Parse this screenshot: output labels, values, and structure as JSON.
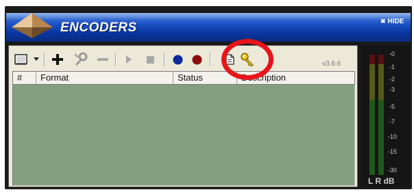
{
  "window": {
    "title": "ENCODERS",
    "hide_label": "HIDE"
  },
  "toolbar": {
    "version": "v3.6.6",
    "buttons": [
      {
        "name": "encoder-menu-icon"
      },
      {
        "name": "dropdown-arrow-icon"
      },
      {
        "name": "add-icon"
      },
      {
        "name": "settings-tools-icon"
      },
      {
        "name": "remove-icon"
      },
      {
        "name": "play-icon"
      },
      {
        "name": "stop-icon"
      },
      {
        "name": "blue-record-icon",
        "color": "#0a2c9c"
      },
      {
        "name": "red-record-icon",
        "color": "#8a0d0d"
      },
      {
        "name": "document-icon"
      },
      {
        "name": "key-icon",
        "color": "#e8c21a"
      }
    ]
  },
  "table": {
    "columns": [
      "#",
      "Format",
      "Status",
      "Description"
    ],
    "rows": []
  },
  "meter": {
    "scale": [
      "-0",
      "-1",
      "-2",
      "-3",
      "-5",
      "-7",
      "-10",
      "-15",
      "-30"
    ],
    "labels": "L R dB"
  },
  "annotation": {
    "color": "#e8141b"
  }
}
